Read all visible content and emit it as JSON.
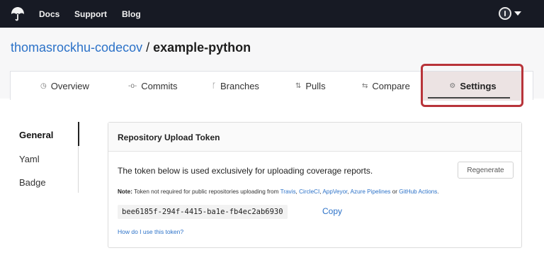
{
  "topbar": {
    "logo_icon": "umbrella-logo-icon",
    "nav": [
      "Docs",
      "Support",
      "Blog"
    ],
    "avatar_icon": "user-avatar-icon",
    "caret_icon": "caret-down-icon"
  },
  "header": {
    "owner": "thomasrockhu-codecov",
    "separator": " / ",
    "repo": "example-python"
  },
  "tabs": [
    {
      "label": "Overview",
      "icon": "gauge-icon",
      "glyph": "◷"
    },
    {
      "label": "Commits",
      "icon": "commit-icon",
      "glyph": "-o-"
    },
    {
      "label": "Branches",
      "icon": "branch-icon",
      "glyph": "ᚴ"
    },
    {
      "label": "Pulls",
      "icon": "pull-request-icon",
      "glyph": "⇅"
    },
    {
      "label": "Compare",
      "icon": "compare-icon",
      "glyph": "⇆"
    },
    {
      "label": "Settings",
      "icon": "gear-icon",
      "glyph": "⚙"
    }
  ],
  "sidebar": {
    "items": [
      "General",
      "Yaml",
      "Badge"
    ]
  },
  "card": {
    "title": "Repository Upload Token",
    "description": "The token below is used exclusively for uploading coverage reports.",
    "regenerate_label": "Regenerate",
    "note_prefix": "Note:",
    "note_text": "Token not required for public repositories uploading from",
    "ci_links": [
      "Travis",
      "CircleCI",
      "AppVeyor",
      "Azure Pipelines",
      "GitHub Actions"
    ],
    "note_or": "or",
    "token": "bee6185f-294f-4415-ba1e-fb4ec2ab6930",
    "copy_label": "Copy",
    "howto_label": "How do I use this token?"
  },
  "colors": {
    "topbar": "#171a24",
    "link": "#2c72c8",
    "highlight": "#b8343a",
    "settings_tab_bg": "#ece3e3"
  }
}
